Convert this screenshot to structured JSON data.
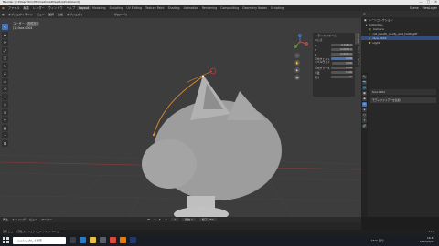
{
  "app": {
    "title": "Blender [C:¥Users¥mofll¥OneDrive¥Desktop¥cat.blend]",
    "window_controls": [
      "—",
      "□",
      "✕"
    ]
  },
  "menubar": {
    "items": [
      "ファイル",
      "編集",
      "レンダー",
      "ウィンドウ",
      "ヘルプ"
    ],
    "workspaces": [
      "Layout",
      "Modeling",
      "Sculpting",
      "UV Editing",
      "Texture Paint",
      "Shading",
      "Animation",
      "Rendering",
      "Compositing",
      "Geometry Nodes",
      "Scripting"
    ],
    "active_workspace": "Layout",
    "scene": "Scene",
    "view_layer": "ViewLayer"
  },
  "viewport": {
    "header": [
      "オブジェクトモード",
      "ビュー",
      "選択",
      "追加",
      "オブジェクト",
      "グローバル"
    ],
    "overlay_line1": "ユーザー・透視投影",
    "overlay_line2": "(1) face.0004",
    "tools": [
      "↖",
      "✥",
      "⟳",
      "⤢",
      "◫",
      "✎",
      "∠",
      "▭",
      "⟲",
      "⌖",
      "◎",
      "⊞",
      "✂",
      "▦",
      "✦",
      "⧉"
    ]
  },
  "npanel": {
    "title": "トランスフォーム",
    "section": "中心点",
    "rows": [
      {
        "label": "X",
        "value": "-0.0162 m"
      },
      {
        "label": "Y",
        "value": "0.00000 m"
      },
      {
        "label": "Z",
        "value": "0.20000 m"
      },
      {
        "label": "平均ウェイト",
        "value": "0.000"
      },
      {
        "label": "ベベルウェイト",
        "value": "0.000"
      },
      {
        "label": "平均クリース",
        "value": "0.000"
      },
      {
        "label": "半径",
        "value": "1.000"
      },
      {
        "label": "傾き",
        "value": "0°"
      }
    ],
    "tabs": [
      "アイテム",
      "ツール",
      "ビュー"
    ]
  },
  "gizmo": {
    "x": "X",
    "y": "Y",
    "z": "Z"
  },
  "outliner": {
    "title": "シーンコレクション",
    "items": [
      {
        "label": "Collection",
        "selected": false
      },
      {
        "label": "Camera",
        "selected": false
      },
      {
        "label": "cat_mouth_cavity_and_tooth.gltf",
        "selected": false
      },
      {
        "label": "face.0004",
        "selected": true
      },
      {
        "label": "Light",
        "selected": false
      }
    ]
  },
  "properties": {
    "object": "face.0004",
    "section": "モディファイアーを追加",
    "icons": [
      "🔧",
      "📷",
      "🌐",
      "▣",
      "◉",
      "⚙",
      "◈",
      "⬡",
      "✦",
      "🔗"
    ]
  },
  "timeline": {
    "menus": [
      "再生",
      "キーイング",
      "ビュー",
      "マーカー"
    ],
    "frame": "1",
    "start": "開始 1",
    "end": "終了 250"
  },
  "status": {
    "text": "選択   ビューを回転   オブジェクトコンテキストメニュー",
    "version": "3.1.0"
  },
  "taskbar": {
    "search_placeholder": "ここに入力して検索",
    "weather": "23°C 曇り",
    "time": "16:33",
    "date": "2022/04/23"
  },
  "colors": {
    "accent": "#4772b3",
    "curve": "#e08a2c",
    "viewport_bg": "#3d3d3d"
  }
}
